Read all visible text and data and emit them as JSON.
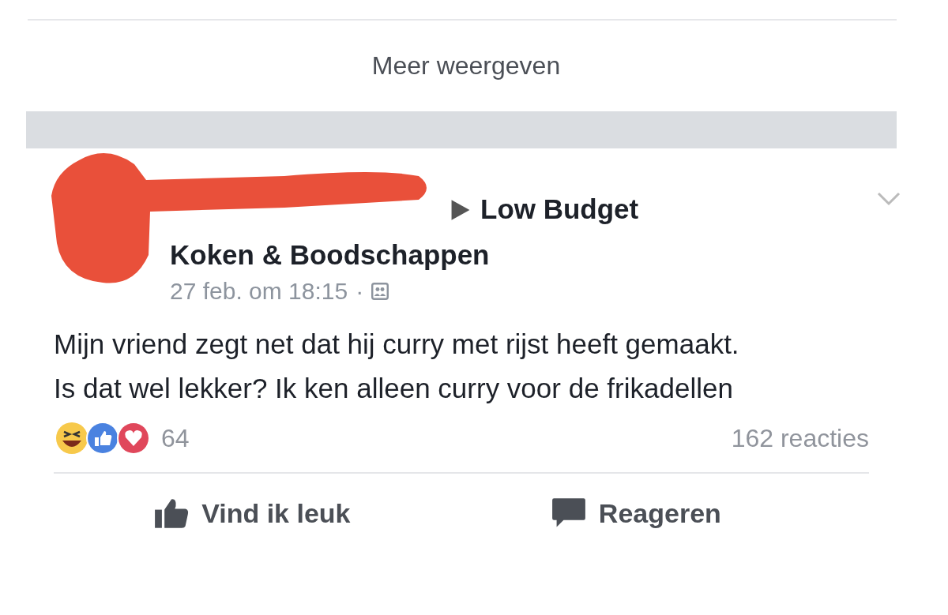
{
  "more_link": "Meer weergeven",
  "post": {
    "group_lines": [
      "Low Budget",
      "Koken & Boodschappen"
    ],
    "timestamp": "27 feb. om 18:15",
    "separator": "·",
    "text": "Mijn vriend zegt net dat hij curry met rijst heeft gemaakt. Is dat wel lekker? Ik ken alleen curry voor de frikadellen",
    "reaction_count": "64",
    "comments_count": "162 reacties",
    "actions": [
      {
        "kind": "like",
        "label": "Vind ik leuk"
      },
      {
        "kind": "comment",
        "label": "Reageren"
      }
    ]
  }
}
